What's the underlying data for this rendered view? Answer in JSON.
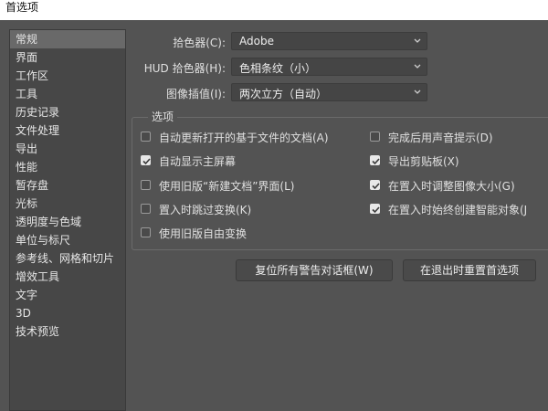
{
  "window": {
    "title": "首选项"
  },
  "sidebar": {
    "items": [
      {
        "label": "常规",
        "selected": true
      },
      {
        "label": "界面"
      },
      {
        "label": "工作区"
      },
      {
        "label": "工具"
      },
      {
        "label": "历史记录"
      },
      {
        "label": "文件处理"
      },
      {
        "label": "导出"
      },
      {
        "label": "性能"
      },
      {
        "label": "暂存盘"
      },
      {
        "label": "光标"
      },
      {
        "label": "透明度与色域"
      },
      {
        "label": "单位与标尺"
      },
      {
        "label": "参考线、网格和切片"
      },
      {
        "label": "增效工具"
      },
      {
        "label": "文字"
      },
      {
        "label": "3D"
      },
      {
        "label": "技术预览"
      }
    ]
  },
  "general": {
    "color_picker": {
      "label": "拾色器(C):",
      "value": "Adobe"
    },
    "hud_color_picker": {
      "label": "HUD 拾色器(H):",
      "value": "色相条纹（小）"
    },
    "interpolation": {
      "label": "图像插值(I):",
      "value": "两次立方（自动）"
    }
  },
  "options": {
    "legend": "选项",
    "left": [
      {
        "label": "自动更新打开的基于文件的文档(A)",
        "checked": false
      },
      {
        "label": "自动显示主屏幕",
        "checked": true
      },
      {
        "label": "使用旧版“新建文档”界面(L)",
        "checked": false
      },
      {
        "label": "置入时跳过变换(K)",
        "checked": false
      },
      {
        "label": "使用旧版自由变换",
        "checked": false
      }
    ],
    "right": [
      {
        "label": "完成后用声音提示(D)",
        "checked": false
      },
      {
        "label": "导出剪贴板(X)",
        "checked": true
      },
      {
        "label": "在置入时调整图像大小(G)",
        "checked": true
      },
      {
        "label": "在置入时始终创建智能对象(J",
        "checked": true
      }
    ]
  },
  "buttons": {
    "reset_warnings": "复位所有警告对话框(W)",
    "reset_prefs": "在退出时重置首选项"
  }
}
